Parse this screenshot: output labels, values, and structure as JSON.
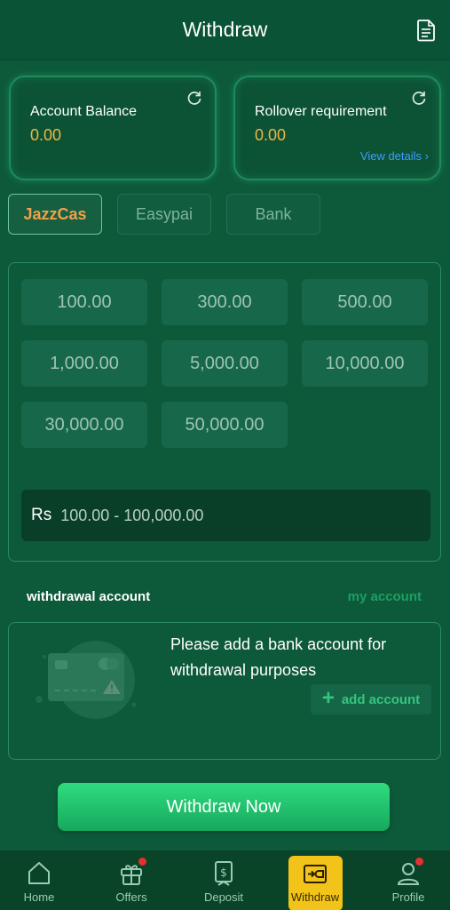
{
  "header": {
    "title": "Withdraw",
    "icon": "document-icon"
  },
  "balance_card": {
    "label": "Account Balance",
    "value": "0.00",
    "icon": "refresh-icon"
  },
  "rollover_card": {
    "label": "Rollover requirement",
    "value": "0.00",
    "link": "View details",
    "link_arrow": "›",
    "icon": "refresh-icon"
  },
  "tabs": [
    {
      "label": "JazzCas",
      "active": true
    },
    {
      "label": "Easypai",
      "active": false
    },
    {
      "label": "Bank",
      "active": false
    }
  ],
  "amounts": [
    "100.00",
    "300.00",
    "500.00",
    "1,000.00",
    "5,000.00",
    "10,000.00",
    "30,000.00",
    "50,000.00"
  ],
  "amount_input": {
    "currency": "Rs",
    "range": "100.00 - 100,000.00"
  },
  "withdrawal_account": {
    "title": "withdrawal account",
    "my_account": "my account",
    "message": "Please add a bank account for withdrawal purposes",
    "add_button": "add account"
  },
  "withdraw_button": "Withdraw Now",
  "nav": [
    {
      "label": "Home",
      "icon": "home-icon",
      "badge": false
    },
    {
      "label": "Offers",
      "icon": "gift-icon",
      "badge": true
    },
    {
      "label": "Deposit",
      "icon": "deposit-icon",
      "badge": false
    },
    {
      "label": "Withdraw",
      "icon": "withdraw-icon",
      "badge": false,
      "active": true
    },
    {
      "label": "Profile",
      "icon": "profile-icon",
      "badge": true
    }
  ],
  "colors": {
    "background": "#0d5a3b",
    "accent": "#f0b540",
    "link": "#3d9cff",
    "button": "#1fbf6b",
    "active_nav": "#f2c318"
  }
}
